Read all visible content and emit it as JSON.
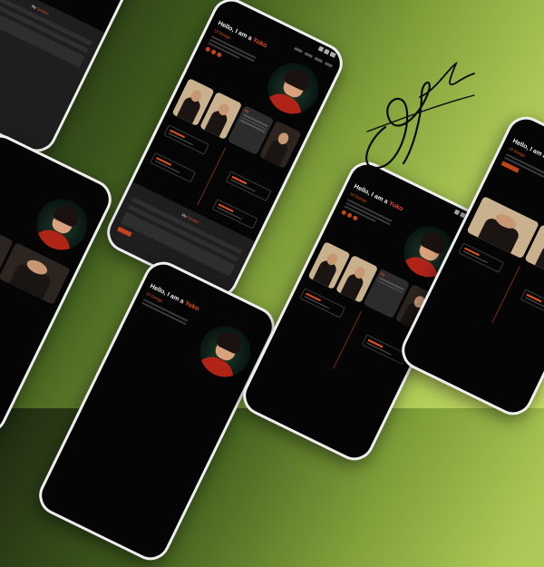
{
  "hero": {
    "greeting_prefix": "Hello, I am a",
    "greeting_name": "Yoko",
    "role": "UI Design"
  },
  "gallery": {
    "card_title": "My"
  },
  "contact": {
    "title_prefix": "My",
    "title_accent": "Contact"
  },
  "colors": {
    "accent": "#e8501f",
    "phone_bg": "#050505",
    "bezel": "#efefef",
    "backdrop_start": "#1f2a12",
    "backdrop_end": "#c3dc63"
  },
  "icons": [
    "signature-icon",
    "portrait-avatar",
    "social-dot-icon"
  ]
}
